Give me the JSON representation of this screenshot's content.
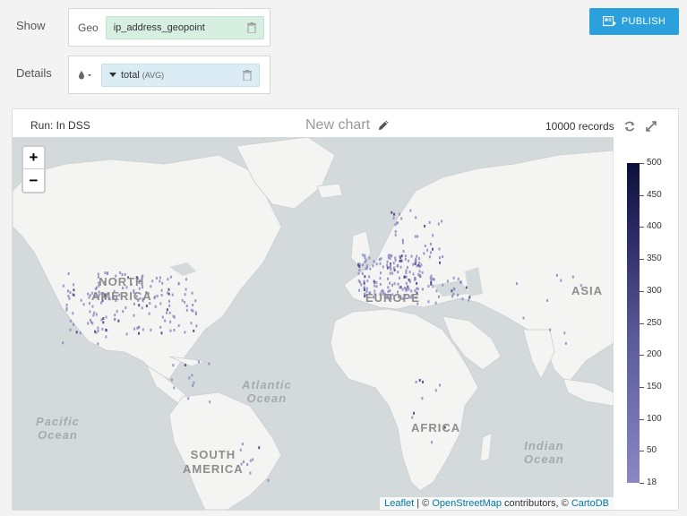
{
  "config": {
    "show_label": "Show",
    "details_label": "Details",
    "geo_label": "Geo",
    "geo_field": "ip_address_geopoint",
    "details_field": "total",
    "details_agg": "(AVG)"
  },
  "publish_label": "PUBLISH",
  "chart": {
    "run_label": "Run: In DSS",
    "title": "New chart",
    "records": "10000 records"
  },
  "map": {
    "zoom_in": "+",
    "zoom_out": "−",
    "labels": {
      "north_america": "NORTH\nAMERICA",
      "south_america": "SOUTH\nAMERICA",
      "europe": "EUROPE",
      "africa": "AFRICA",
      "asia": "ASIA",
      "atlantic": "Atlantic\nOcean",
      "pacific": "Pacific\nOcean",
      "indian": "Indian\nOcean"
    },
    "attribution": {
      "leaflet": "Leaflet",
      "sep": " | © ",
      "osm": "OpenStreetMap",
      "contrib": " contributors, © ",
      "carto": "CartoDB"
    }
  },
  "legend": {
    "max": 500,
    "min": 18,
    "ticks": [
      "500",
      "450",
      "400",
      "350",
      "300",
      "250",
      "200",
      "150",
      "100",
      "50",
      "18"
    ]
  },
  "colors": {
    "accent": "#2aa1dc",
    "geo_pill": "#d6efe0",
    "measure_pill": "#dcecf5",
    "point": "#8a87c2"
  }
}
